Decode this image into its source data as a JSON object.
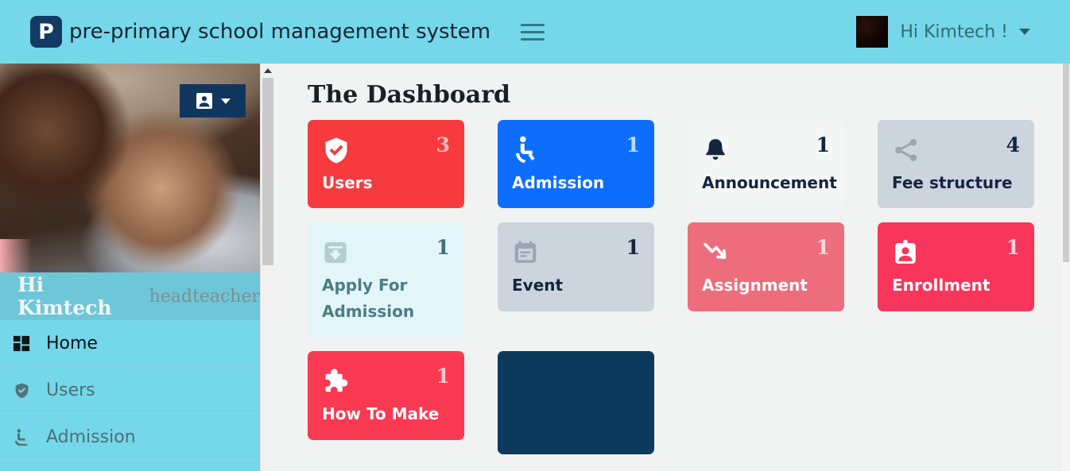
{
  "header": {
    "logo_letter": "P",
    "logo_icon": "logo-p-icon",
    "title": "pre-primary school management system",
    "menu_icon": "hamburger-menu-icon",
    "user_greeting": "Hi Kimtech !",
    "avatar_icon": "user-avatar-photo",
    "caret_icon": "chevron-down-icon",
    "bg_color": "#74d7ea"
  },
  "sidebar": {
    "cover_photo_alt": "profile-cover-photo",
    "profile_button": {
      "icon": "user-card-icon",
      "caret_icon": "chevron-down-icon",
      "bg_color": "#10365e"
    },
    "greeting_name": "Hi Kimtech",
    "greeting_role": "headteacher",
    "items": [
      {
        "label": "Home",
        "icon": "dashboard-grid-icon",
        "active": true
      },
      {
        "label": "Users",
        "icon": "shield-check-icon",
        "active": false
      },
      {
        "label": "Admission",
        "icon": "wheelchair-icon",
        "active": false
      }
    ],
    "bg_color": "#74d7ea"
  },
  "scrollbars": {
    "sidebar_up_arrow_icon": "chevron-up-icon",
    "sidebar_thumb": "sidebar-scroll-thumb",
    "page_thumb": "page-scroll-thumb"
  },
  "main": {
    "page_title": "The Dashboard",
    "cards": [
      {
        "label": "Users",
        "count": "3",
        "icon": "shield-check-icon",
        "bg": "#f73a3e",
        "fg": "#ffffff",
        "count_fg": "#fbb7b9"
      },
      {
        "label": "Admission",
        "count": "1",
        "icon": "wheelchair-icon",
        "bg": "#0d6efd",
        "fg": "#ffffff",
        "count_fg": "#bcd9ff"
      },
      {
        "label": "Announcement",
        "count": "1",
        "icon": "bell-icon",
        "bg": "#f4f5f5",
        "fg": "#14253f",
        "count_fg": "#14253f"
      },
      {
        "label": "Fee structure",
        "count": "4",
        "icon": "share-nodes-icon",
        "bg": "#ccd4de",
        "fg": "#14253f",
        "count_fg": "#14253f"
      },
      {
        "label": "Apply For Admission",
        "count": "1",
        "icon": "download-box-icon",
        "bg": "#e2f5f9",
        "fg": "#4c7d84",
        "count_fg": "#3f6f77"
      },
      {
        "label": "Event",
        "count": "1",
        "icon": "calendar-icon",
        "bg": "#ccd4de",
        "fg": "#14253f",
        "count_fg": "#14253f"
      },
      {
        "label": "Assignment",
        "count": "1",
        "icon": "trending-down-icon",
        "bg": "#ed6d7c",
        "fg": "#ffffff",
        "count_fg": "#fad6da"
      },
      {
        "label": "Enrollment",
        "count": "1",
        "icon": "id-badge-icon",
        "bg": "#f8355a",
        "fg": "#ffffff",
        "count_fg": "#ffd3db"
      },
      {
        "label": "How To Make",
        "count": "1",
        "icon": "puzzle-piece-icon",
        "bg": "#f93a52",
        "fg": "#ffffff",
        "count_fg": "#fbc4cb"
      }
    ],
    "blank_card": {
      "label": "",
      "bg": "#0b3a5c"
    },
    "bg_color": "#f1f2f2"
  }
}
